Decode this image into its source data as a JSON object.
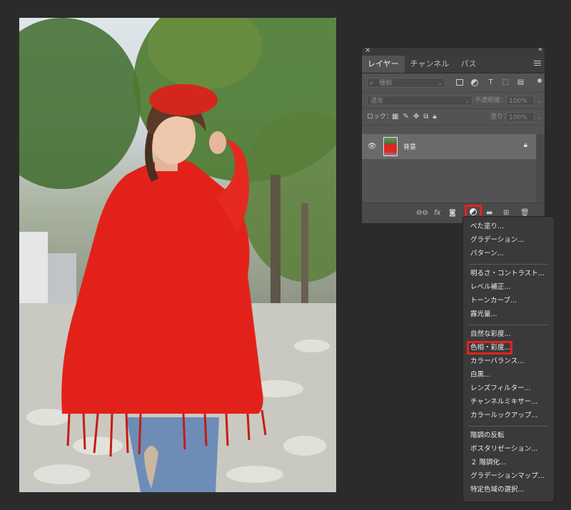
{
  "panel": {
    "tabs": [
      {
        "label": "レイヤー"
      },
      {
        "label": "チャンネル"
      },
      {
        "label": "パス"
      }
    ],
    "filter": {
      "placeholder": "種類"
    },
    "blend_mode": "通常",
    "opacity_label": "不透明度：",
    "opacity_value": "100%",
    "lock_label": "ロック：",
    "fill_label": "塗り：",
    "fill_value": "100%",
    "layer": {
      "name": "背景"
    }
  },
  "menu": {
    "groups": [
      [
        "べた塗り...",
        "グラデーション...",
        "パターン..."
      ],
      [
        "明るさ・コントラスト...",
        "レベル補正...",
        "トーンカーブ...",
        "露光量..."
      ],
      [
        "自然な彩度...",
        "色相・彩度...",
        "カラーバランス...",
        "白黒...",
        "レンズフィルター...",
        "チャンネルミキサー...",
        "カラールックアップ..."
      ],
      [
        "階調の反転",
        "ポスタリゼーション...",
        "２ 階調化...",
        "グラデーションマップ...",
        "特定色域の選択..."
      ]
    ],
    "highlighted": "色相・彩度...",
    "highlight_color": "#e8221a"
  },
  "colors": {
    "background": "#2b2b2b",
    "panel": "#535353",
    "accent": "#e8221a"
  }
}
